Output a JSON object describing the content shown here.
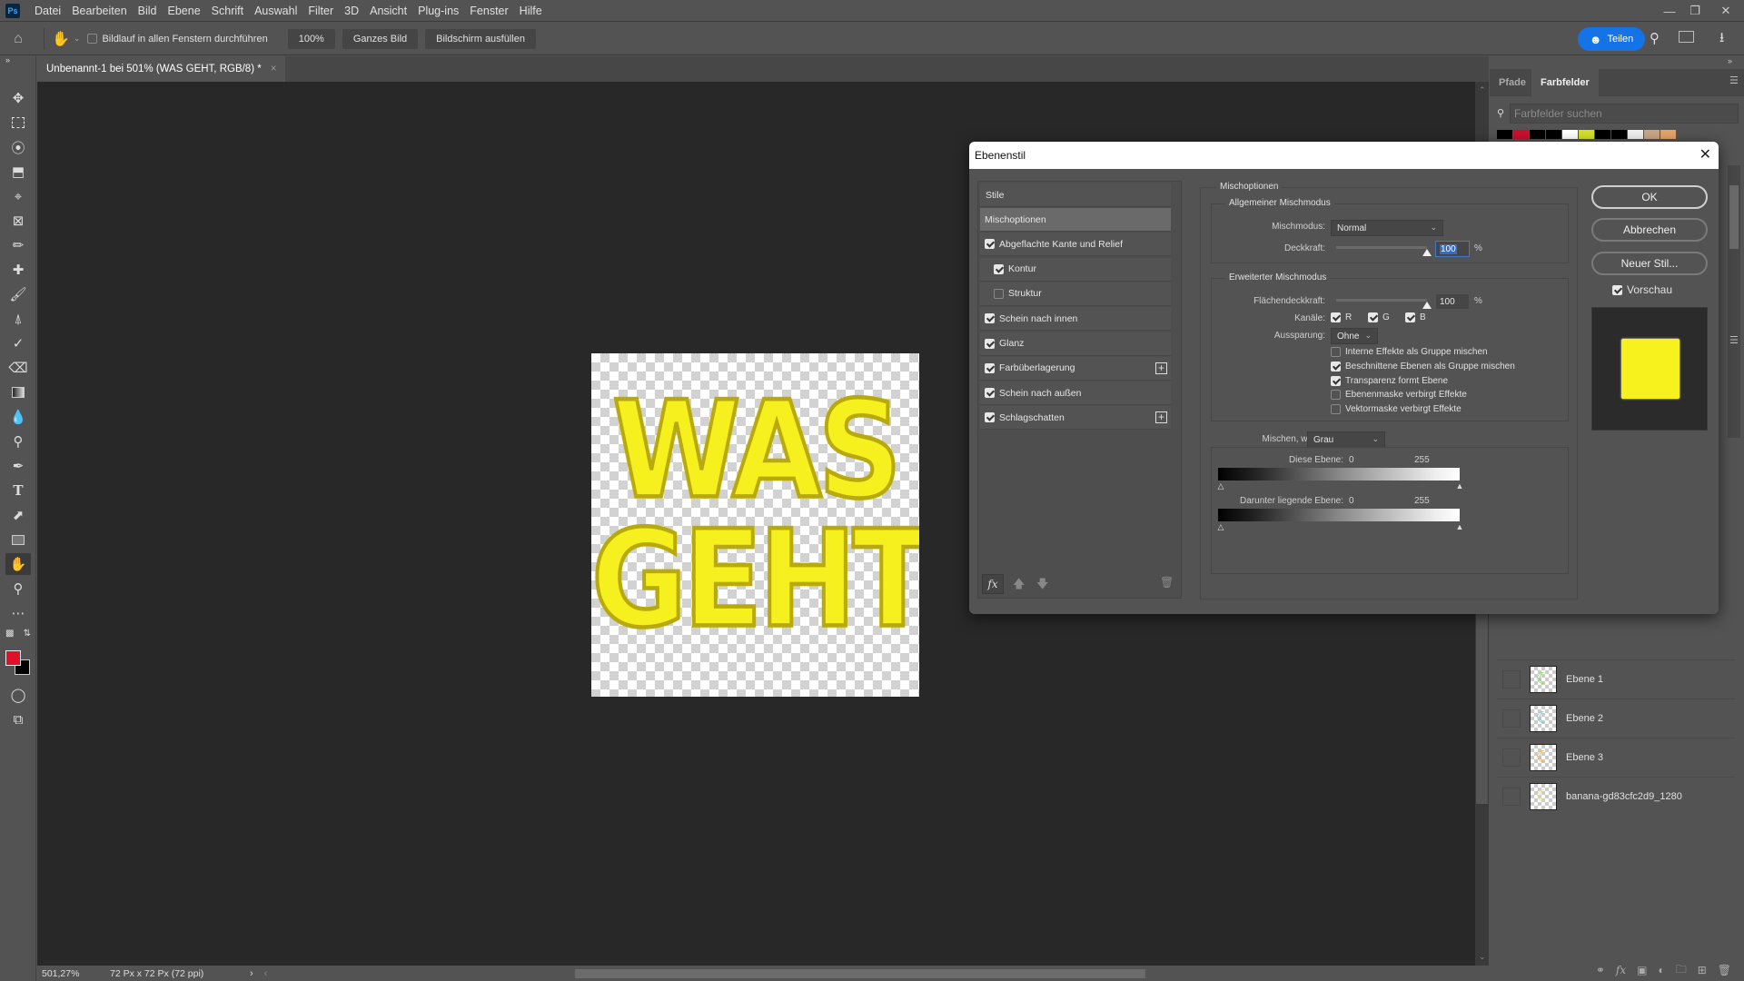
{
  "app": {
    "logo": "Ps",
    "menu": [
      "Datei",
      "Bearbeiten",
      "Bild",
      "Ebene",
      "Schrift",
      "Auswahl",
      "Filter",
      "3D",
      "Ansicht",
      "Plug-ins",
      "Fenster",
      "Hilfe"
    ]
  },
  "options_bar": {
    "scroll_all_windows_label": "Bildlauf in allen Fenstern durchführen",
    "scroll_all_windows_checked": false,
    "zoom_100_label": "100%",
    "fit_screen_label": "Ganzes Bild",
    "fill_screen_label": "Bildschirm ausfüllen",
    "share_label": "Teilen"
  },
  "document": {
    "tab_title": "Unbenannt-1 bei 501% (WAS GEHT, RGB/8) *",
    "canvas_text_line1": "WAS",
    "canvas_text_line2": "GEHT",
    "text_color": "#f5f01e",
    "status_zoom": "501,27%",
    "status_info": "72 Px x 72 Px (72 ppi)"
  },
  "tools": {
    "foreground_color": "#e0102a",
    "background_color": "#000000",
    "active_tool": "hand-tool"
  },
  "right_panel": {
    "tabs": [
      "Pfade",
      "Farbfelder"
    ],
    "active_tab": "Farbfelder",
    "search_placeholder": "Farbfelder suchen",
    "swatches": [
      "#000000",
      "#c8102e",
      "#000000",
      "#000000",
      "#ffffff",
      "#d4e02a",
      "#000000",
      "#000000",
      "#f0f0f0",
      "#c9a68a",
      "#e2a56a"
    ],
    "layers": [
      {
        "name": "Ebene 1",
        "thumb_color": "#7ed957"
      },
      {
        "name": "Ebene 2",
        "thumb_color": "#4fd6e0"
      },
      {
        "name": "Ebene 3",
        "thumb_color": "#f0a83c"
      },
      {
        "name": "banana-gd83cfc2d9_1280",
        "thumb_color": "#f2e53a"
      }
    ]
  },
  "dialog": {
    "title": "Ebenenstil",
    "styles_header": "Stile",
    "styles": [
      {
        "label": "Mischoptionen",
        "checkbox": false,
        "checked": false,
        "selected": true,
        "indent": false,
        "plus": false
      },
      {
        "label": "Abgeflachte Kante und Relief",
        "checkbox": true,
        "checked": true,
        "selected": false,
        "indent": false,
        "plus": false
      },
      {
        "label": "Kontur",
        "checkbox": true,
        "checked": true,
        "selected": false,
        "indent": true,
        "plus": false
      },
      {
        "label": "Struktur",
        "checkbox": true,
        "checked": false,
        "selected": false,
        "indent": true,
        "plus": false
      },
      {
        "label": "Schein nach innen",
        "checkbox": true,
        "checked": true,
        "selected": false,
        "indent": false,
        "plus": false
      },
      {
        "label": "Glanz",
        "checkbox": true,
        "checked": true,
        "selected": false,
        "indent": false,
        "plus": false
      },
      {
        "label": "Farbüberlagerung",
        "checkbox": true,
        "checked": true,
        "selected": false,
        "indent": false,
        "plus": true
      },
      {
        "label": "Schein nach außen",
        "checkbox": true,
        "checked": true,
        "selected": false,
        "indent": false,
        "plus": false
      },
      {
        "label": "Schlagschatten",
        "checkbox": true,
        "checked": true,
        "selected": false,
        "indent": false,
        "plus": true
      }
    ],
    "blend_options": {
      "section_title": "Mischoptionen",
      "general_title": "Allgemeiner Mischmodus",
      "blend_mode_label": "Mischmodus:",
      "blend_mode_value": "Normal",
      "opacity_label": "Deckkraft:",
      "opacity_value": "100",
      "opacity_percent": 100,
      "percent_sign": "%",
      "advanced_title": "Erweiterter Mischmodus",
      "fill_opacity_label": "Flächendeckkraft:",
      "fill_opacity_value": "100",
      "fill_opacity_percent": 100,
      "channels_label": "Kanäle:",
      "channels": [
        {
          "label": "R",
          "checked": true
        },
        {
          "label": "G",
          "checked": true
        },
        {
          "label": "B",
          "checked": true
        }
      ],
      "knockout_label": "Aussparung:",
      "knockout_value": "Ohne",
      "options": [
        {
          "label": "Interne Effekte als Gruppe mischen",
          "checked": false
        },
        {
          "label": "Beschnittene Ebenen als Gruppe mischen",
          "checked": true
        },
        {
          "label": "Transparenz formt Ebene",
          "checked": true
        },
        {
          "label": "Ebenenmaske verbirgt Effekte",
          "checked": false
        },
        {
          "label": "Vektormaske verbirgt Effekte",
          "checked": false
        }
      ],
      "blend_if_label": "Mischen, wenn:",
      "blend_if_value": "Grau",
      "this_layer_label": "Diese Ebene:",
      "this_layer_min": "0",
      "this_layer_max": "255",
      "underlying_label": "Darunter liegende Ebene:",
      "underlying_min": "0",
      "underlying_max": "255"
    },
    "buttons": {
      "ok": "OK",
      "cancel": "Abbrechen",
      "new_style": "Neuer Stil...",
      "preview_label": "Vorschau",
      "preview_checked": true
    },
    "preview_color": "#f7f21e"
  }
}
